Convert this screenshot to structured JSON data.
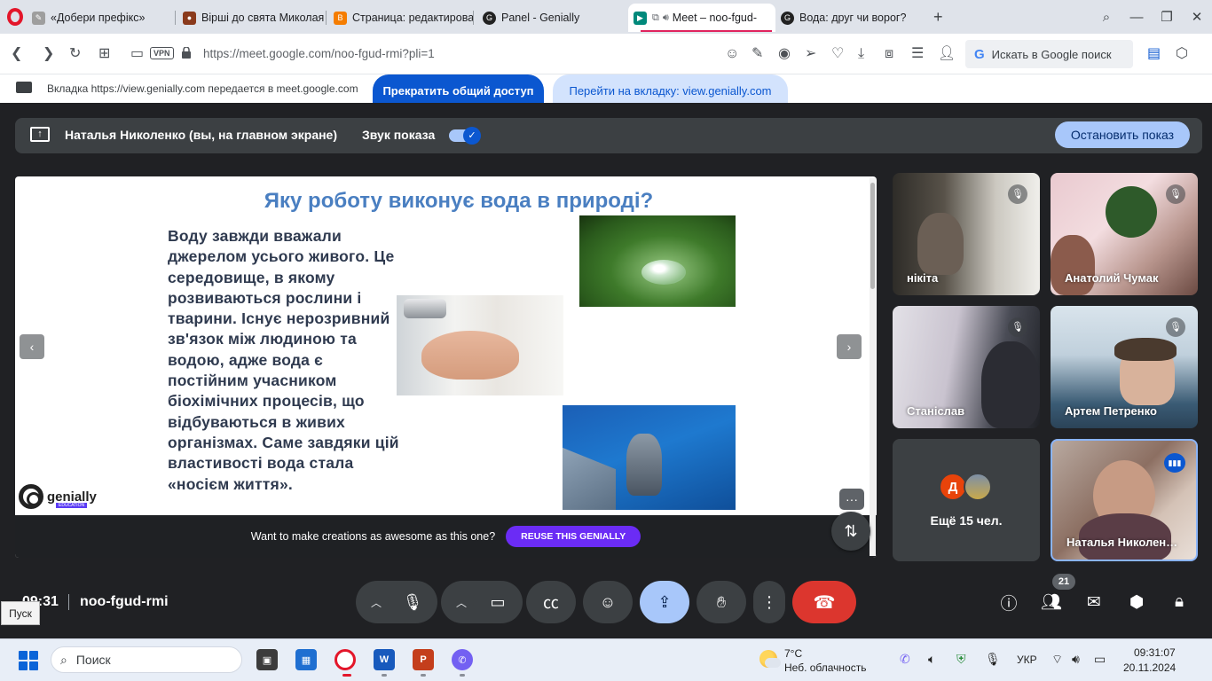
{
  "browser": {
    "tabs": [
      {
        "title": "«Добери префікс»",
        "icon": "edit-page-icon",
        "color": "#7a7a7a"
      },
      {
        "title": "Вірші до свята Миколая",
        "icon": "site-icon",
        "color": "#8a3a1c"
      },
      {
        "title": "Страница: редактирован",
        "icon": "blogger-icon",
        "color": "#f57d00"
      },
      {
        "title": "Panel - Genially",
        "icon": "genially-icon",
        "color": "#222222"
      },
      {
        "title": "Meet – noo-fgud-",
        "icon": "meet-icon",
        "color": "#00897b"
      },
      {
        "title": "Вода: друг чи ворог?",
        "icon": "genially-icon",
        "color": "#222222"
      }
    ],
    "url": "https://meet.google.com/noo-fgud-rmi?pli=1",
    "vpn_label": "VPN",
    "search_placeholder": "Искать в Google поиск",
    "search_logo": "G"
  },
  "infobar": {
    "text": "Вкладка https://view.genially.com передается в meet.google.com",
    "stop_share": "Прекратить общий доступ",
    "goto_tab": "Перейти на вкладку: view.genially.com"
  },
  "presenting": {
    "label": "Наталья Николенко (вы, на главном экране)",
    "sound_label": "Звук показа",
    "sound_on": true,
    "stop_button": "Остановить показ"
  },
  "slide": {
    "title": "Яку роботу виконує вода в природі?",
    "body": "Воду завжди вважали джерелом усього живого. Це середовище, в якому розвиваються рослини і тварини. Існує нерозривний зв'язок між людиною та водою, адже вода є постійним учасником біохімічних процесів, що відбуваються в живих організмах. Саме завдяки цій властивості вода стала «носієм життя».",
    "logo_text": "genially",
    "logo_sub": "EDUCATION",
    "promo_text": "Want to make creations as awesome as this one?",
    "reuse_button": "REUSE THIS GENIALLY"
  },
  "participants": [
    {
      "name": "нікіта",
      "muted": true
    },
    {
      "name": "Анатолий Чумак",
      "muted": true
    },
    {
      "name": "Станіслав",
      "muted": true
    },
    {
      "name": "Артем Петренко",
      "muted": true
    },
    {
      "name": "Наталья Николен…",
      "muted": false,
      "speaking": true
    }
  ],
  "more": {
    "avatar_letter": "Д",
    "label": "Ещё 15 чел."
  },
  "meeting": {
    "time": "09:31",
    "code": "noo-fgud-rmi",
    "people_count": "21"
  },
  "start_tooltip": "Пуск",
  "taskbar": {
    "search_placeholder": "Поиск",
    "weather_temp": "7°C",
    "weather_desc": "Неб. облачность",
    "language": "УКР",
    "time": "09:31:07",
    "date": "20.11.2024"
  }
}
